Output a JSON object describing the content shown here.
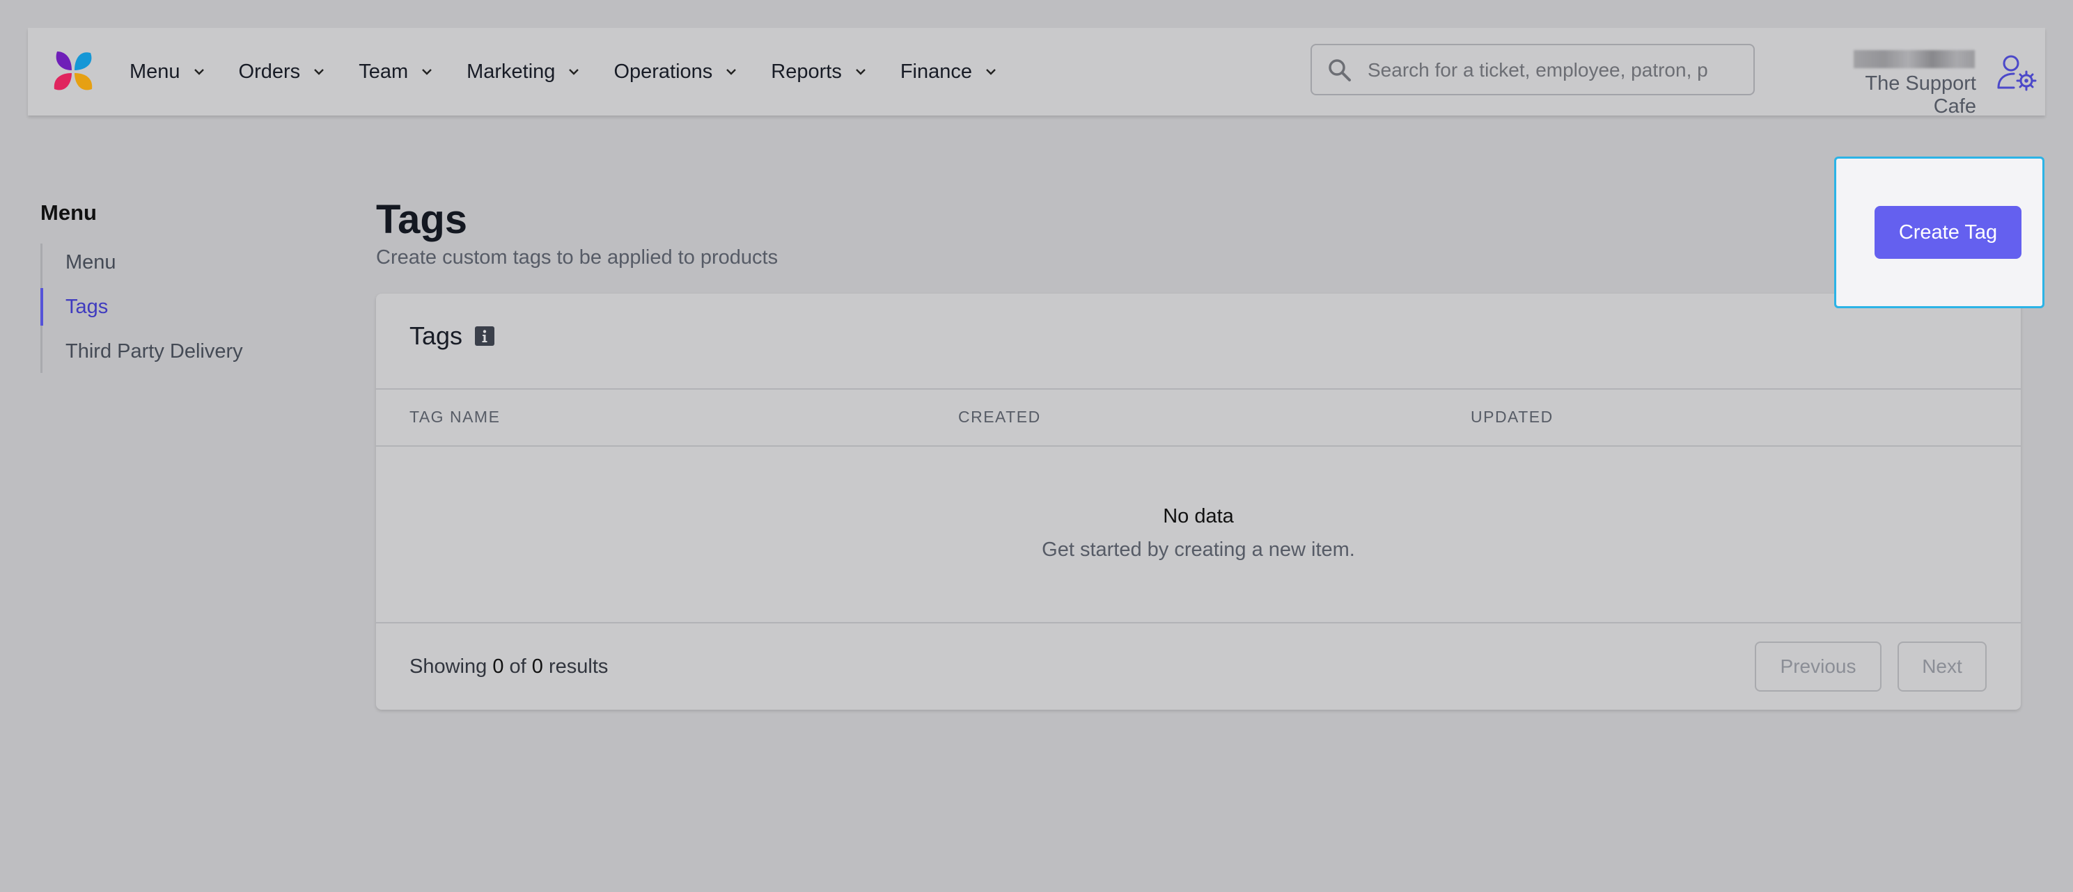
{
  "header": {
    "nav": [
      {
        "label": "Menu"
      },
      {
        "label": "Orders"
      },
      {
        "label": "Team"
      },
      {
        "label": "Marketing"
      },
      {
        "label": "Operations"
      },
      {
        "label": "Reports"
      },
      {
        "label": "Finance"
      }
    ],
    "search": {
      "placeholder": "Search for a ticket, employee, patron, p"
    },
    "store_name": "The Support Cafe",
    "icons": {
      "logo": "pinwheel-logo",
      "search": "search-icon",
      "user": "user-settings-icon",
      "chevron": "chevron-down-icon"
    }
  },
  "sidebar": {
    "title": "Menu",
    "items": [
      {
        "label": "Menu",
        "active": false
      },
      {
        "label": "Tags",
        "active": true
      },
      {
        "label": "Third Party Delivery",
        "active": false
      }
    ]
  },
  "page": {
    "title": "Tags",
    "subtitle": "Create custom tags to be applied to products",
    "create_button": "Create Tag"
  },
  "table": {
    "title": "Tags",
    "columns": [
      "TAG NAME",
      "CREATED",
      "UPDATED"
    ],
    "empty_title": "No data",
    "empty_subtitle": "Get started by creating a new item.",
    "results_prefix": "Showing",
    "results_from": "0",
    "results_of": "of",
    "results_total": "0",
    "results_suffix": "results",
    "prev_label": "Previous",
    "next_label": "Next"
  },
  "colors": {
    "accent": "#6460ef",
    "active_nav": "#3f3bbf",
    "highlight_border": "#2bb3e6"
  }
}
